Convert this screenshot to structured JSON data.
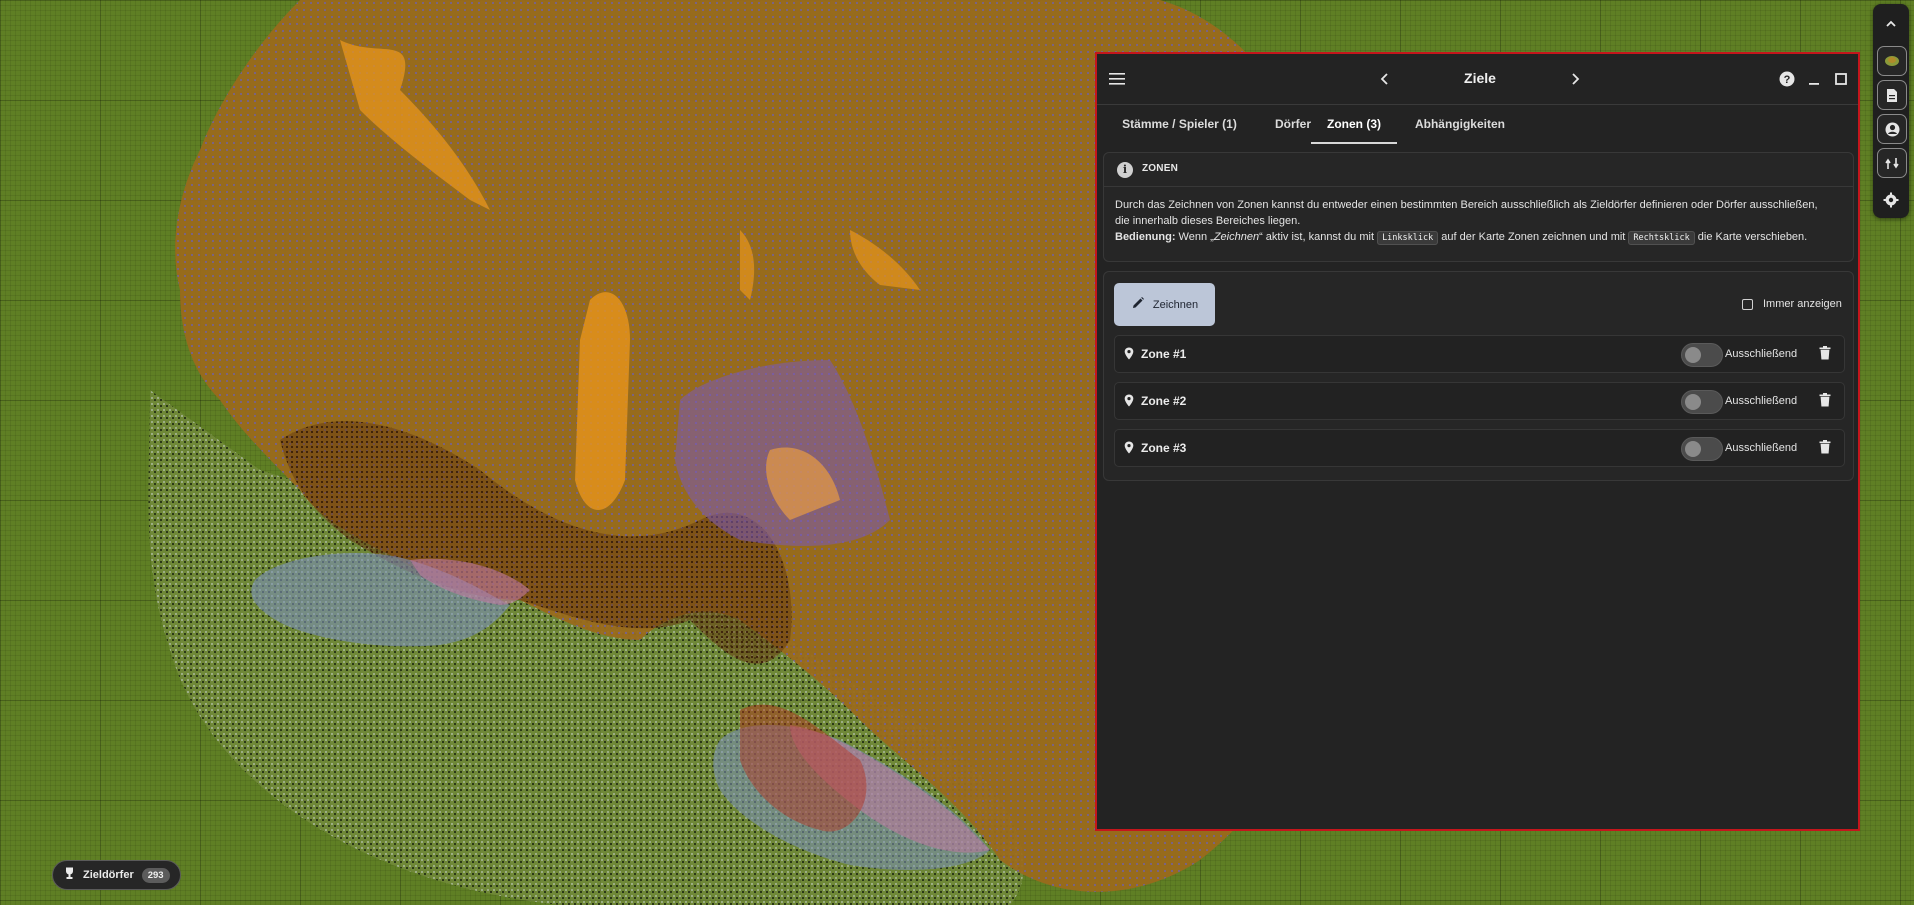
{
  "window": {
    "title": "Ziele",
    "tabs": [
      {
        "label": "Stämme / Spieler (1)",
        "active": false
      },
      {
        "label": "Dörfer",
        "active": false
      },
      {
        "label": "Zonen (3)",
        "active": true
      },
      {
        "label": "Abhängigkeiten",
        "active": false
      }
    ],
    "border_color": "#c4161c"
  },
  "info": {
    "title": "ZONEN",
    "text1": "Durch das Zeichnen von Zonen kannst du entweder einen bestimmten Bereich ausschließlich als Zieldörfer definieren oder Dörfer ausschließen, die innerhalb dieses Bereiches liegen.",
    "label_bold": "Bedienung:",
    "text2a": " Wenn „",
    "text2_italic": "Zeichnen",
    "text2b": "“ aktiv ist, kannst du mit ",
    "kbd1": "Linksklick",
    "text2c": " auf der Karte Zonen zeichnen und mit ",
    "kbd2": "Rechtsklick",
    "text2d": " die Karte verschieben."
  },
  "zones": {
    "draw_button": "Zeichnen",
    "always_show": "Immer anzeigen",
    "always_show_checked": false,
    "items": [
      {
        "name": "Zone #1",
        "toggle_label": "Ausschließend",
        "exclusive": false
      },
      {
        "name": "Zone #2",
        "toggle_label": "Ausschließend",
        "exclusive": false
      },
      {
        "name": "Zone #3",
        "toggle_label": "Ausschließend",
        "exclusive": false
      }
    ]
  },
  "badge": {
    "label": "Zieldörfer",
    "count": "293"
  },
  "toolbar": {
    "icons": [
      "chevron-up-icon",
      "map-icon",
      "document-icon",
      "account-icon",
      "route-icon",
      "settings-icon"
    ]
  },
  "colors": {
    "map_green": "#5f7f24",
    "tribe_brown": "#9a6a1c",
    "zone_purple": "#7a5ab8",
    "zone_blue": "#7a8fb8",
    "zone_pink": "#c07aa0",
    "accent_button": "#bcc6d8"
  }
}
